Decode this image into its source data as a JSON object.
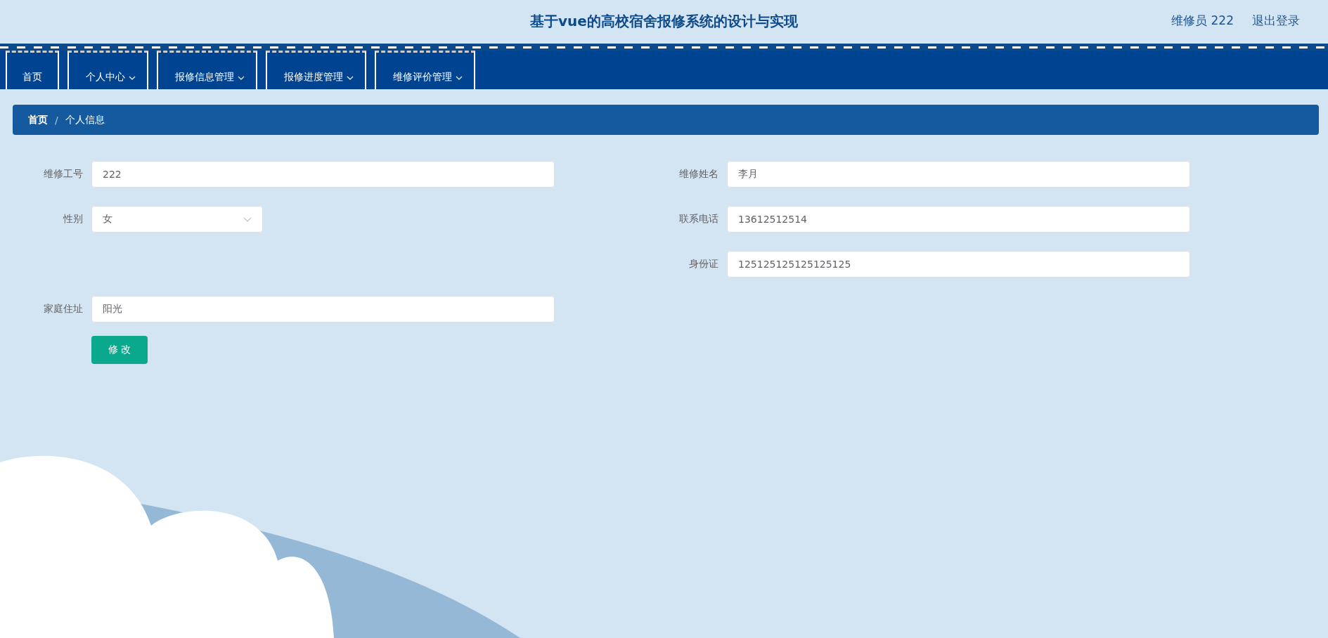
{
  "header": {
    "title": "基于vue的高校宿舍报修系统的设计与实现",
    "user": "维修员 222",
    "logout": "退出登录"
  },
  "nav": [
    {
      "label": "首页",
      "dropdown": false
    },
    {
      "label": "个人中心",
      "dropdown": true
    },
    {
      "label": "报修信息管理",
      "dropdown": true
    },
    {
      "label": "报修进度管理",
      "dropdown": true
    },
    {
      "label": "维修评价管理",
      "dropdown": true
    }
  ],
  "breadcrumb": {
    "items": [
      "首页",
      "个人信息"
    ],
    "separator": "/"
  },
  "form": {
    "rows": [
      {
        "left": {
          "label": "维修工号",
          "kind": "text",
          "value": "222"
        },
        "right": {
          "label": "维修姓名",
          "kind": "text",
          "value": "李月"
        }
      },
      {
        "left": {
          "label": "性别",
          "kind": "select",
          "value": "女"
        },
        "right": {
          "label": "联系电话",
          "kind": "text",
          "value": "13612512514"
        }
      },
      {
        "right": {
          "label": "身份证",
          "kind": "text",
          "value": "125125125125125125"
        }
      },
      {
        "left": {
          "label": "家庭住址",
          "kind": "text",
          "value": "阳光"
        }
      }
    ],
    "submit": "修 改"
  }
}
